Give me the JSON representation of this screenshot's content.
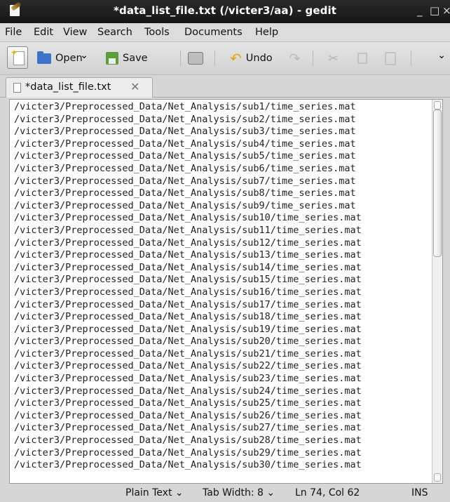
{
  "window": {
    "title": "*data_list_file.txt (/victer3/aa) - gedit",
    "minimize": "_",
    "maximize": "□",
    "close": "×"
  },
  "menu": [
    "File",
    "Edit",
    "View",
    "Search",
    "Tools",
    "Documents",
    "Help"
  ],
  "toolbar": {
    "open_label": "Open",
    "open_arrow": "⌄",
    "save_label": "Save",
    "undo_label": "Undo",
    "overflow_arrow": "⌄"
  },
  "tab": {
    "label": "*data_list_file.txt",
    "close": "✕"
  },
  "editor": {
    "lines": [
      "/victer3/Preprocessed_Data/Net_Analysis/sub1/time_series.mat",
      "/victer3/Preprocessed_Data/Net_Analysis/sub2/time_series.mat",
      "/victer3/Preprocessed_Data/Net_Analysis/sub3/time_series.mat",
      "/victer3/Preprocessed_Data/Net_Analysis/sub4/time_series.mat",
      "/victer3/Preprocessed_Data/Net_Analysis/sub5/time_series.mat",
      "/victer3/Preprocessed_Data/Net_Analysis/sub6/time_series.mat",
      "/victer3/Preprocessed_Data/Net_Analysis/sub7/time_series.mat",
      "/victer3/Preprocessed_Data/Net_Analysis/sub8/time_series.mat",
      "/victer3/Preprocessed_Data/Net_Analysis/sub9/time_series.mat",
      "/victer3/Preprocessed_Data/Net_Analysis/sub10/time_series.mat",
      "/victer3/Preprocessed_Data/Net_Analysis/sub11/time_series.mat",
      "/victer3/Preprocessed_Data/Net_Analysis/sub12/time_series.mat",
      "/victer3/Preprocessed_Data/Net_Analysis/sub13/time_series.mat",
      "/victer3/Preprocessed_Data/Net_Analysis/sub14/time_series.mat",
      "/victer3/Preprocessed_Data/Net_Analysis/sub15/time_series.mat",
      "/victer3/Preprocessed_Data/Net_Analysis/sub16/time_series.mat",
      "/victer3/Preprocessed_Data/Net_Analysis/sub17/time_series.mat",
      "/victer3/Preprocessed_Data/Net_Analysis/sub18/time_series.mat",
      "/victer3/Preprocessed_Data/Net_Analysis/sub19/time_series.mat",
      "/victer3/Preprocessed_Data/Net_Analysis/sub20/time_series.mat",
      "/victer3/Preprocessed_Data/Net_Analysis/sub21/time_series.mat",
      "/victer3/Preprocessed_Data/Net_Analysis/sub22/time_series.mat",
      "/victer3/Preprocessed_Data/Net_Analysis/sub23/time_series.mat",
      "/victer3/Preprocessed_Data/Net_Analysis/sub24/time_series.mat",
      "/victer3/Preprocessed_Data/Net_Analysis/sub25/time_series.mat",
      "/victer3/Preprocessed_Data/Net_Analysis/sub26/time_series.mat",
      "/victer3/Preprocessed_Data/Net_Analysis/sub27/time_series.mat",
      "/victer3/Preprocessed_Data/Net_Analysis/sub28/time_series.mat",
      "/victer3/Preprocessed_Data/Net_Analysis/sub29/time_series.mat",
      "/victer3/Preprocessed_Data/Net_Analysis/sub30/time_series.mat"
    ]
  },
  "status": {
    "language": "Plain Text ⌄",
    "tab_width": "Tab Width:  8 ⌄",
    "position": "Ln 74, Col 62",
    "mode": "INS"
  }
}
